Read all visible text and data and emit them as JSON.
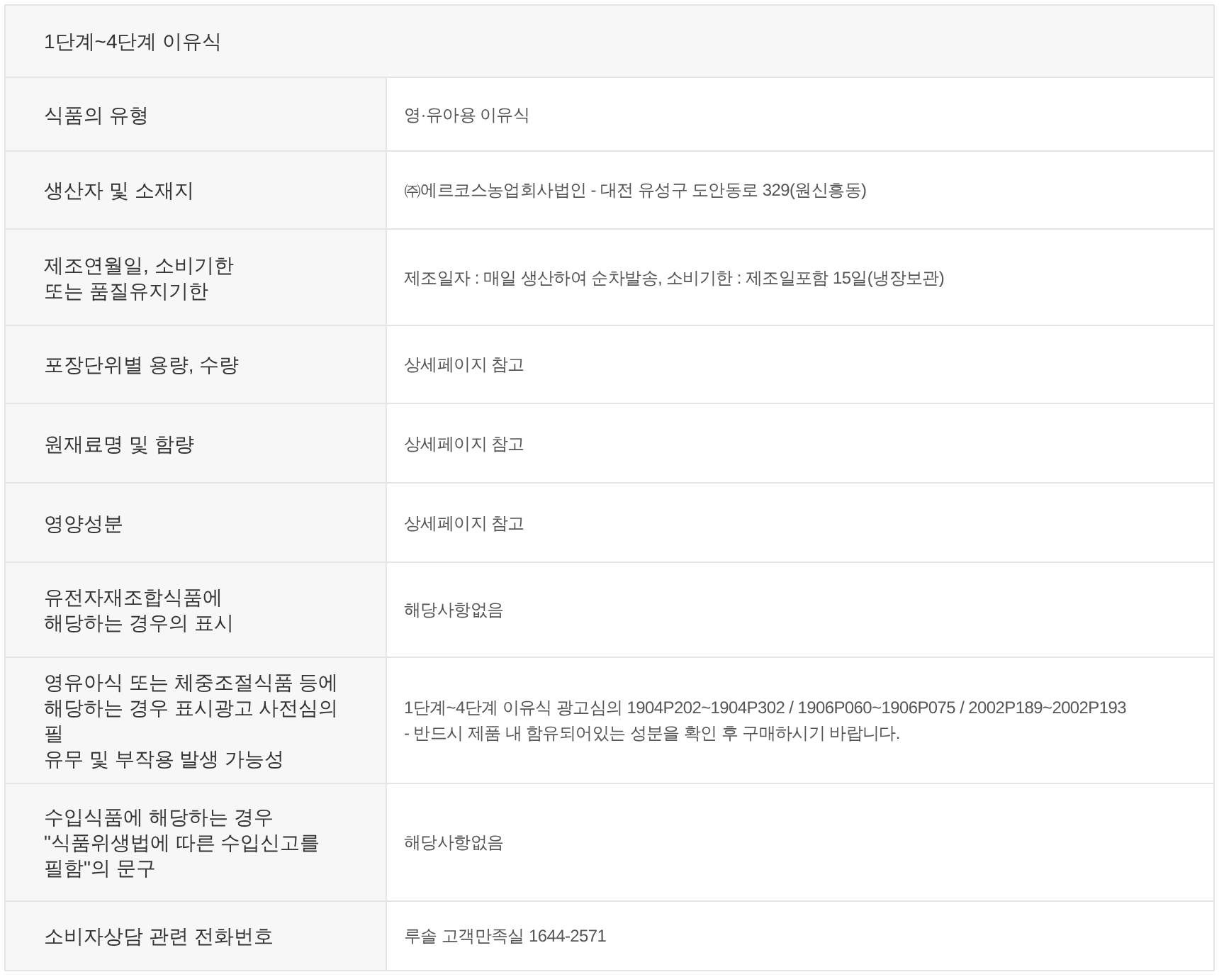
{
  "title": "1단계~4단계 이유식",
  "rows": [
    {
      "label": "식품의 유형",
      "value": "영·유아용 이유식"
    },
    {
      "label": "생산자 및 소재지",
      "value": "㈜에르코스농업회사법인 - 대전 유성구 도안동로 329(원신흥동)"
    },
    {
      "label": "제조연월일, 소비기한\n또는 품질유지기한",
      "value": "제조일자 : 매일 생산하여 순차발송, 소비기한 : 제조일포함 15일(냉장보관)"
    },
    {
      "label": "포장단위별 용량, 수량",
      "value": "상세페이지 참고"
    },
    {
      "label": "원재료명 및 함량",
      "value": "상세페이지 참고"
    },
    {
      "label": "영양성분",
      "value": "상세페이지 참고"
    },
    {
      "label": "유전자재조합식품에\n해당하는 경우의 표시",
      "value": "해당사항없음"
    },
    {
      "label": "영유아식 또는 체중조절식품 등에\n해당하는 경우 표시광고 사전심의필\n유무 및 부작용 발생 가능성",
      "value": "1단계~4단계 이유식 광고심의 1904P202~1904P302  /  1906P060~1906P075 / 2002P189~2002P193\n- 반드시 제품 내 함유되어있는 성분을 확인 후 구매하시기 바랍니다."
    },
    {
      "label": "수입식품에 해당하는 경우\n\"식품위생법에 따른 수입신고를\n필함\"의 문구",
      "value": "해당사항없음"
    },
    {
      "label": "소비자상담 관련 전화번호",
      "value": "루솔 고객만족실 1644-2571"
    }
  ]
}
